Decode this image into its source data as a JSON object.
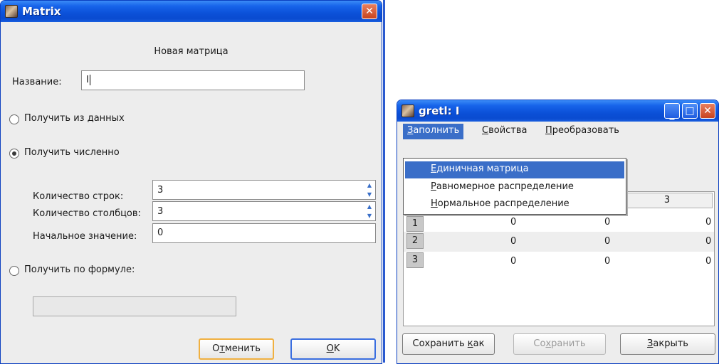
{
  "matrix_dialog": {
    "title": "Matrix",
    "heading": "Новая матрица",
    "name_label": "Название:",
    "name_value": "I",
    "radio_from_data": "Получить из данных",
    "radio_numeric": "Получить численно",
    "rows_label": "Количество строк:",
    "rows_value": "3",
    "cols_label": "Количество столбцов:",
    "cols_value": "3",
    "initial_label": "Начальное значение:",
    "initial_value": "0",
    "radio_formula": "Получить по формуле:",
    "formula_value": "",
    "cancel_prefix": "О",
    "cancel_access": "т",
    "cancel_rest": "менить",
    "ok_access": "O",
    "ok_rest": "K"
  },
  "gretl_window": {
    "title": "gretl: I",
    "menu": {
      "fill_access": "З",
      "fill_rest": "аполнить",
      "props_access": "С",
      "props_rest": "войства",
      "transform_access": "П",
      "transform_rest": "реобразовать"
    },
    "dropdown": {
      "identity_access": "Е",
      "identity_rest": "диничная матрица",
      "uniform_access": "Р",
      "uniform_rest": "авномерное распределение",
      "normal_access": "Н",
      "normal_rest": "ормальное распределение"
    },
    "grid": {
      "col3_header": "3",
      "row1_label": "1",
      "row2_label": "2",
      "row3_label": "3",
      "r1c1": "0",
      "r1c2": "0",
      "r1c3": "0",
      "r2c1": "0",
      "r2c2": "0",
      "r2c3": "0",
      "r3c1": "0",
      "r3c2": "0",
      "r3c3": "0"
    },
    "buttons": {
      "save_as_prefix": "Сохранить ",
      "save_as_access": "к",
      "save_as_rest": "ак",
      "save_prefix": "Со",
      "save_access": "х",
      "save_rest": "ранить",
      "close_access": "З",
      "close_rest": "акрыть"
    }
  },
  "colors": {
    "titlebar": "#0b50d8",
    "menu_highlight": "#3a6ec8",
    "close_button": "#c8431e"
  }
}
